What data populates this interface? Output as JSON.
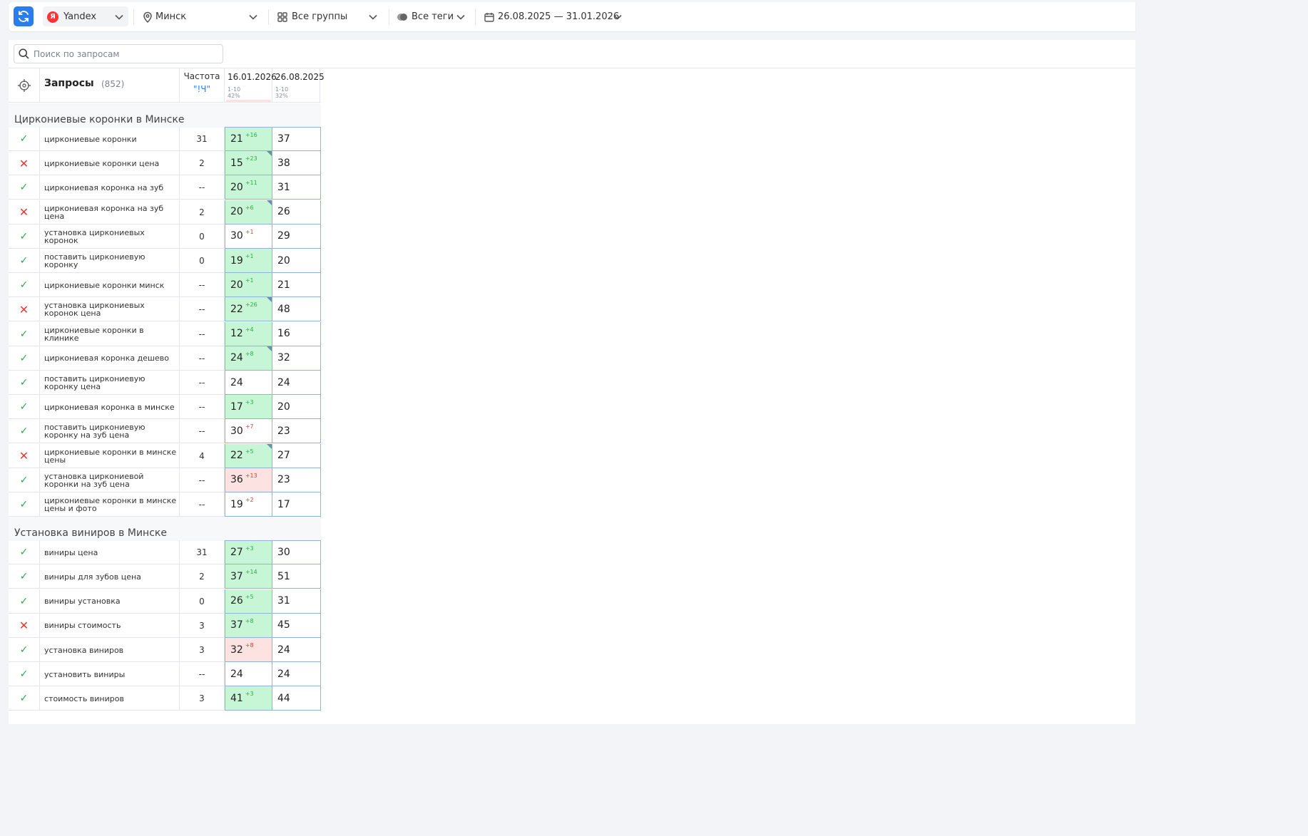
{
  "toolbar": {
    "engine": "Yandex",
    "engine_badge": "Я",
    "region": "Минск",
    "groups": "Все группы",
    "tags": "Все теги",
    "date_range": "26.08.2025 — 31.01.2026"
  },
  "search": {
    "placeholder": "Поиск по запросам"
  },
  "table_header": {
    "title": "Запросы",
    "count": "(852)",
    "freq_label": "Частота",
    "freq_type": "\"!Ч\"",
    "columns": [
      {
        "date": "16.01.2026",
        "range": "1-10",
        "percent": "42%"
      },
      {
        "date": "26.08.2025",
        "range": "1-10",
        "percent": "32%"
      }
    ]
  },
  "groups": [
    {
      "title": "Циркониевые коронки в Минске",
      "rows": [
        {
          "status": "ok",
          "query": "циркониевые коронки",
          "freq": "31",
          "pos1": "21",
          "delta": "+16",
          "dir": "up",
          "bg": "green",
          "flag": false,
          "pos2": "37"
        },
        {
          "status": "bad",
          "query": "циркониевые коронки цена",
          "freq": "2",
          "pos1": "15",
          "delta": "+23",
          "dir": "up",
          "bg": "green",
          "flag": true,
          "pos2": "38"
        },
        {
          "status": "ok",
          "query": "циркониевая коронка на зуб",
          "freq": "--",
          "pos1": "20",
          "delta": "+11",
          "dir": "up",
          "bg": "green",
          "flag": false,
          "pos2": "31"
        },
        {
          "status": "bad",
          "query": "циркониевая коронка на зуб цена",
          "freq": "2",
          "pos1": "20",
          "delta": "+6",
          "dir": "up",
          "bg": "green",
          "flag": true,
          "pos2": "26"
        },
        {
          "status": "ok",
          "query": "установка циркониевых коронок",
          "freq": "0",
          "pos1": "30",
          "delta": "+1",
          "dir": "down",
          "bg": "none",
          "flag": false,
          "pos2": "29"
        },
        {
          "status": "ok",
          "query": "поставить циркониевую коронку",
          "freq": "0",
          "pos1": "19",
          "delta": "+1",
          "dir": "up",
          "bg": "green",
          "flag": false,
          "pos2": "20"
        },
        {
          "status": "ok",
          "query": "циркониевые коронки минск",
          "freq": "--",
          "pos1": "20",
          "delta": "+1",
          "dir": "up",
          "bg": "green",
          "flag": false,
          "pos2": "21"
        },
        {
          "status": "bad",
          "query": "установка циркониевых коронок цена",
          "freq": "--",
          "pos1": "22",
          "delta": "+26",
          "dir": "up",
          "bg": "green",
          "flag": true,
          "pos2": "48"
        },
        {
          "status": "ok",
          "query": "циркониевые коронки в клинике",
          "freq": "--",
          "pos1": "12",
          "delta": "+4",
          "dir": "up",
          "bg": "green",
          "flag": false,
          "pos2": "16"
        },
        {
          "status": "ok",
          "query": "циркониевая коронка дешево",
          "freq": "--",
          "pos1": "24",
          "delta": "+8",
          "dir": "up",
          "bg": "green",
          "flag": true,
          "pos2": "32"
        },
        {
          "status": "ok",
          "query": "поставить циркониевую коронку цена",
          "freq": "--",
          "pos1": "24",
          "delta": "",
          "dir": "up",
          "bg": "none",
          "flag": false,
          "pos2": "24"
        },
        {
          "status": "ok",
          "query": "циркониевая коронка в минске",
          "freq": "--",
          "pos1": "17",
          "delta": "+3",
          "dir": "up",
          "bg": "green",
          "flag": false,
          "pos2": "20"
        },
        {
          "status": "ok",
          "query": "поставить циркониевую коронку на зуб цена",
          "freq": "--",
          "pos1": "30",
          "delta": "+7",
          "dir": "down",
          "bg": "none",
          "flag": false,
          "pos2": "23"
        },
        {
          "status": "bad",
          "query": "циркониевые коронки в минске цены",
          "freq": "4",
          "pos1": "22",
          "delta": "+5",
          "dir": "up",
          "bg": "green",
          "flag": true,
          "pos2": "27"
        },
        {
          "status": "ok",
          "query": "установка циркониевой коронки на зуб цена",
          "freq": "--",
          "pos1": "36",
          "delta": "+13",
          "dir": "down",
          "bg": "red",
          "flag": false,
          "pos2": "23"
        },
        {
          "status": "ok",
          "query": "циркониевые коронки в минске цены и фото",
          "freq": "--",
          "pos1": "19",
          "delta": "+2",
          "dir": "down",
          "bg": "none",
          "flag": false,
          "pos2": "17"
        }
      ]
    },
    {
      "title": "Установка виниров в Минске",
      "rows": [
        {
          "status": "ok",
          "query": "виниры цена",
          "freq": "31",
          "pos1": "27",
          "delta": "+3",
          "dir": "up",
          "bg": "green",
          "flag": false,
          "pos2": "30"
        },
        {
          "status": "ok",
          "query": "виниры для зубов цена",
          "freq": "2",
          "pos1": "37",
          "delta": "+14",
          "dir": "up",
          "bg": "green",
          "flag": false,
          "pos2": "51"
        },
        {
          "status": "ok",
          "query": "виниры установка",
          "freq": "0",
          "pos1": "26",
          "delta": "+5",
          "dir": "up",
          "bg": "green",
          "flag": false,
          "pos2": "31"
        },
        {
          "status": "bad",
          "query": "виниры стоимость",
          "freq": "3",
          "pos1": "37",
          "delta": "+8",
          "dir": "up",
          "bg": "green",
          "flag": false,
          "pos2": "45"
        },
        {
          "status": "ok",
          "query": "установка виниров",
          "freq": "3",
          "pos1": "32",
          "delta": "+8",
          "dir": "down",
          "bg": "red",
          "flag": false,
          "pos2": "24"
        },
        {
          "status": "ok",
          "query": "установить виниры",
          "freq": "--",
          "pos1": "24",
          "delta": "",
          "dir": "up",
          "bg": "none",
          "flag": false,
          "pos2": "24"
        },
        {
          "status": "ok",
          "query": "стоимость виниров",
          "freq": "3",
          "pos1": "41",
          "delta": "+3",
          "dir": "up",
          "bg": "green",
          "flag": false,
          "pos2": "44"
        }
      ]
    }
  ]
}
